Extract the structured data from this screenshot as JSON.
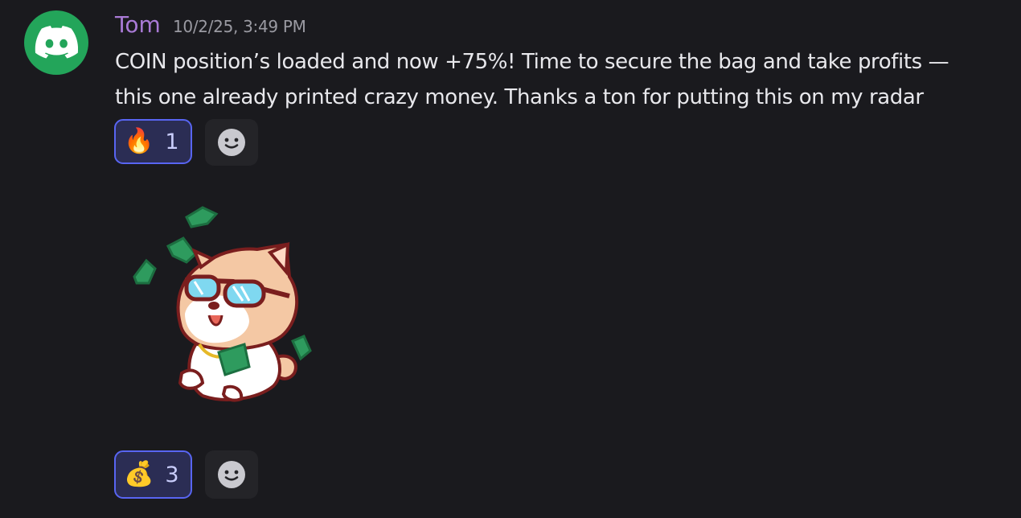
{
  "message": {
    "username": "Tom",
    "timestamp": "10/2/25, 3:49 PM",
    "line1": "COIN position’s loaded and now +75%! Time to secure the bag and take profits —",
    "line2": "this one already printed crazy money. Thanks a ton for putting this on my radar"
  },
  "reactions": [
    {
      "emoji": "🔥",
      "count": "1"
    },
    {
      "emoji": "💰",
      "count": "3"
    }
  ],
  "colors": {
    "background": "#1a1a1e",
    "username": "#a97ad6",
    "avatar": "#23a55a",
    "reaction_border": "#5865f2",
    "reaction_bg": "#2b2d54"
  },
  "icons": {
    "avatar": "discord-logo-icon",
    "add_reaction": "smiley-icon",
    "sticker": "shiba-money-sticker"
  }
}
